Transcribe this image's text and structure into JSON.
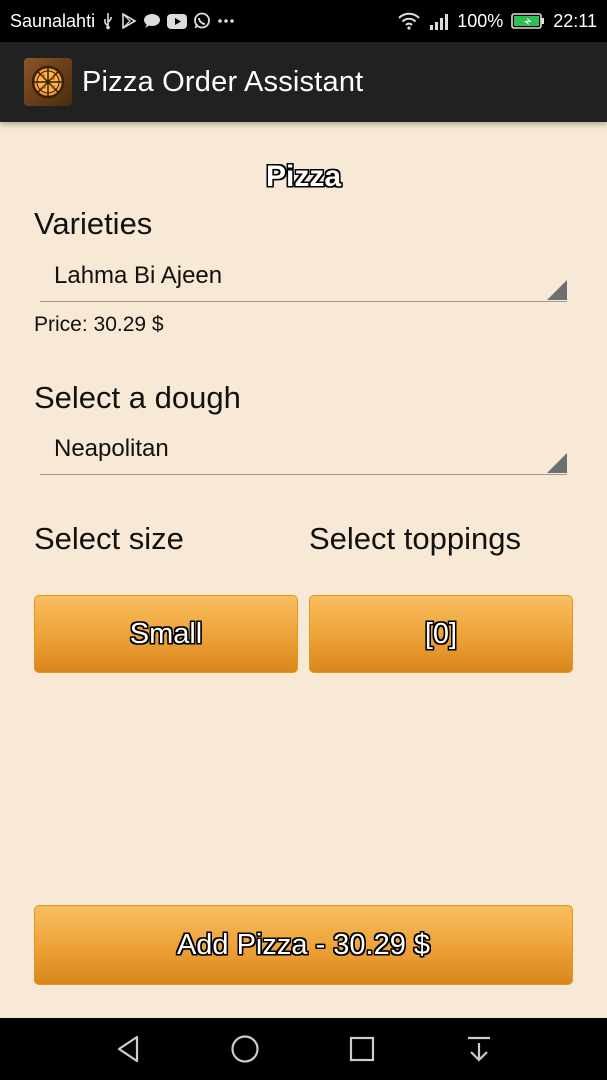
{
  "status_bar": {
    "carrier": "Saunalahti",
    "battery": "100%",
    "time": "22:11",
    "left_icons": [
      "usb-icon",
      "play-store-icon",
      "chat-icon",
      "youtube-icon",
      "whatsapp-icon",
      "more-dots-icon"
    ],
    "right_icons": [
      "wifi-icon",
      "signal-icon",
      "battery-charging-icon"
    ]
  },
  "app_bar": {
    "title": "Pizza Order Assistant",
    "logo_icon": "pizza-logo-icon"
  },
  "form": {
    "heading": "Pizza",
    "varieties_label": "Varieties",
    "variety_selected": "Lahma Bi Ajeen",
    "price_text": "Price: 30.29 $",
    "dough_label": "Select a dough",
    "dough_selected": "Neapolitan",
    "size_label": "Select size",
    "toppings_label": "Select toppings",
    "size_button": "Small",
    "toppings_button": "[0]",
    "add_button": "Add Pizza - 30.29 $"
  },
  "nav_bar": {
    "icons": [
      "back-icon",
      "home-icon",
      "recents-icon",
      "notifications-pulldown-icon"
    ]
  },
  "colors": {
    "background": "#f7e9d6",
    "button_top": "#f8be5f",
    "button_bottom": "#d9861a",
    "app_bar": "#212121"
  }
}
